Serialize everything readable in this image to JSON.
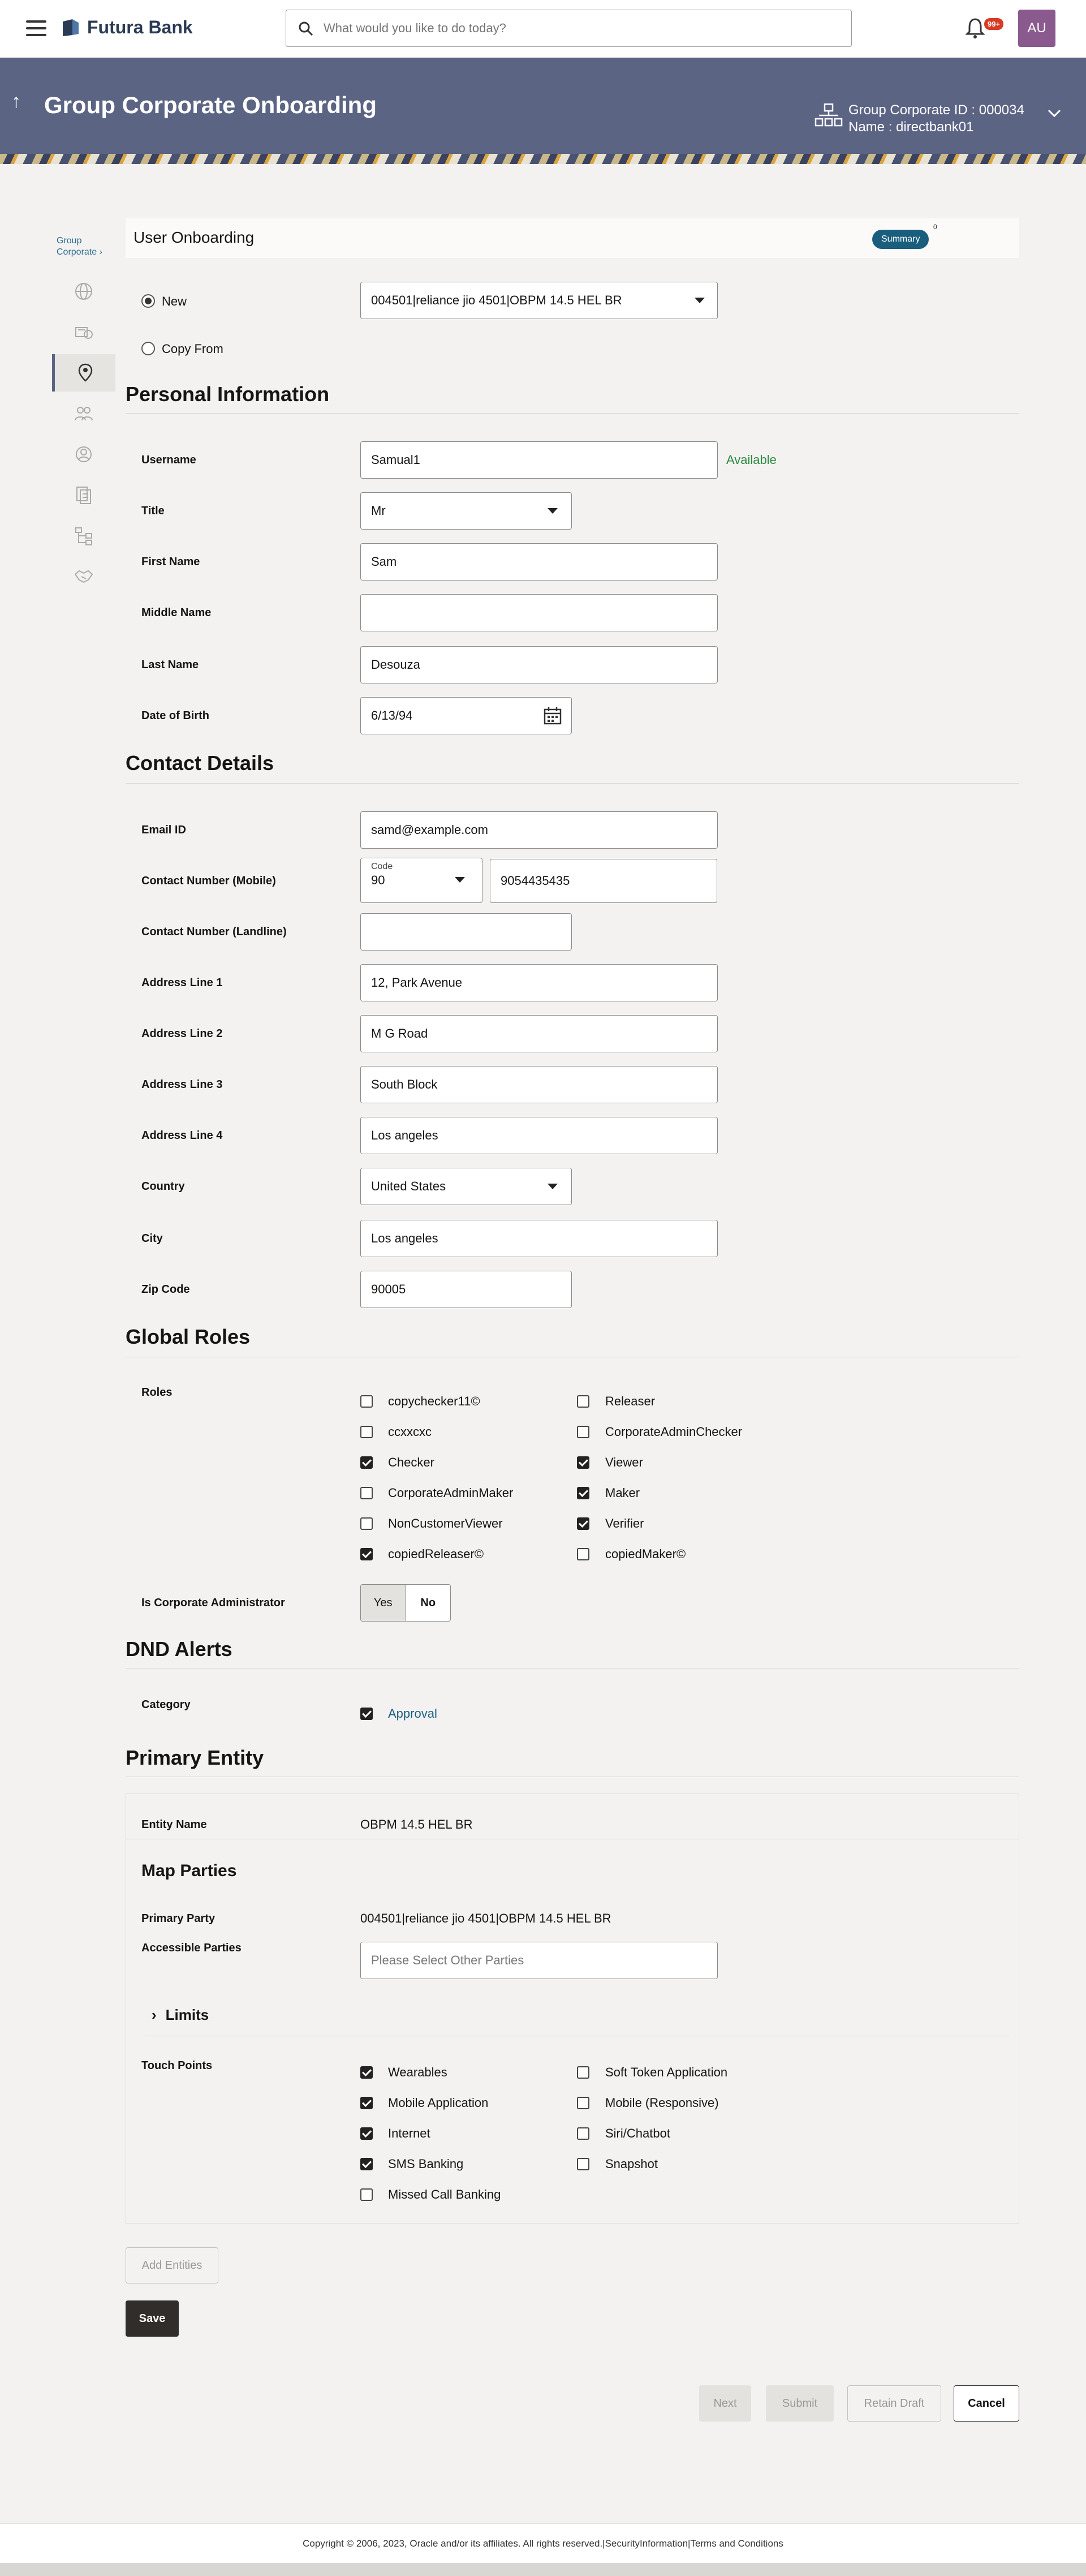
{
  "header": {
    "logo_text": "Futura Bank",
    "search_placeholder": "What would you like to do today?",
    "notification_count": "99+",
    "avatar_initials": "AU"
  },
  "banner": {
    "title": "Group Corporate Onboarding",
    "corporate_id": "Group Corporate ID : 000034",
    "name": "Name : directbank01"
  },
  "sidebar": {
    "label_line1": "Group",
    "label_line2": "Corporate",
    "items": [
      "globe-icon",
      "bank-icon",
      "user-location-icon",
      "group-icon",
      "settings-user-icon",
      "document-icon",
      "tree-icon",
      "handshake-icon"
    ]
  },
  "onboarding": {
    "title": "User Onboarding",
    "summary_label": "Summary",
    "summary_count": "0",
    "option_new": "New",
    "option_copy": "Copy From",
    "party_select": "004501|reliance jio 4501|OBPM 14.5 HEL BR"
  },
  "personal": {
    "title": "Personal Information",
    "username_label": "Username",
    "username_value": "Samual1",
    "available": "Available",
    "title_label": "Title",
    "title_value": "Mr",
    "first_name_label": "First Name",
    "first_name_value": "Sam",
    "middle_name_label": "Middle Name",
    "middle_name_value": "",
    "last_name_label": "Last Name",
    "last_name_value": "Desouza",
    "dob_label": "Date of Birth",
    "dob_value": "6/13/94"
  },
  "contact": {
    "title": "Contact Details",
    "email_label": "Email ID",
    "email_value": "samd@example.com",
    "mobile_label": "Contact Number (Mobile)",
    "code_label": "Code",
    "code_value": "90",
    "mobile_value": "9054435435",
    "landline_label": "Contact Number (Landline)",
    "landline_value": "",
    "addr1_label": "Address Line 1",
    "addr1_value": "12, Park Avenue",
    "addr2_label": "Address Line 2",
    "addr2_value": "M G Road",
    "addr3_label": "Address Line 3",
    "addr3_value": "South Block",
    "addr4_label": "Address Line 4",
    "addr4_value": "Los angeles",
    "country_label": "Country",
    "country_value": "United States",
    "city_label": "City",
    "city_value": "Los angeles",
    "zip_label": "Zip Code",
    "zip_value": "90005"
  },
  "roles": {
    "title": "Global Roles",
    "roles_label": "Roles",
    "left": [
      {
        "label": "copychecker11©",
        "checked": false
      },
      {
        "label": "ccxxcxc",
        "checked": false
      },
      {
        "label": "Checker",
        "checked": true
      },
      {
        "label": "CorporateAdminMaker",
        "checked": false
      },
      {
        "label": "NonCustomerViewer",
        "checked": false
      },
      {
        "label": "copiedReleaser©",
        "checked": true
      }
    ],
    "right": [
      {
        "label": "Releaser",
        "checked": false
      },
      {
        "label": "CorporateAdminChecker",
        "checked": false
      },
      {
        "label": "Viewer",
        "checked": true
      },
      {
        "label": "Maker",
        "checked": true
      },
      {
        "label": "Verifier",
        "checked": true
      },
      {
        "label": "copiedMaker©",
        "checked": false
      }
    ],
    "admin_label": "Is Corporate Administrator",
    "yes": "Yes",
    "no": "No"
  },
  "dnd": {
    "title": "DND Alerts",
    "category_label": "Category",
    "approval": "Approval"
  },
  "entity": {
    "title": "Primary Entity",
    "entity_name_label": "Entity Name",
    "entity_name_value": "OBPM 14.5 HEL BR",
    "map_parties": "Map Parties",
    "primary_party_label": "Primary Party",
    "primary_party_value": "004501|reliance jio 4501|OBPM 14.5 HEL BR",
    "accessible_label": "Accessible Parties",
    "accessible_placeholder": "Please Select Other Parties",
    "limits": "Limits",
    "touch_label": "Touch Points",
    "touch_left": [
      {
        "label": "Wearables",
        "checked": true
      },
      {
        "label": "Mobile Application",
        "checked": true
      },
      {
        "label": "Internet",
        "checked": true
      },
      {
        "label": "SMS Banking",
        "checked": true
      },
      {
        "label": "Missed Call Banking",
        "checked": false
      }
    ],
    "touch_right": [
      {
        "label": "Soft Token Application",
        "checked": false
      },
      {
        "label": "Mobile (Responsive)",
        "checked": false
      },
      {
        "label": "Siri/Chatbot",
        "checked": false
      },
      {
        "label": "Snapshot",
        "checked": false
      }
    ]
  },
  "actions": {
    "add_entities": "Add Entities",
    "save": "Save",
    "next": "Next",
    "submit": "Submit",
    "retain_draft": "Retain Draft",
    "cancel": "Cancel"
  },
  "footer": {
    "text": "Copyright © 2006, 2023, Oracle and/or its affiliates. All rights reserved.|SecurityInformation|Terms and Conditions"
  }
}
